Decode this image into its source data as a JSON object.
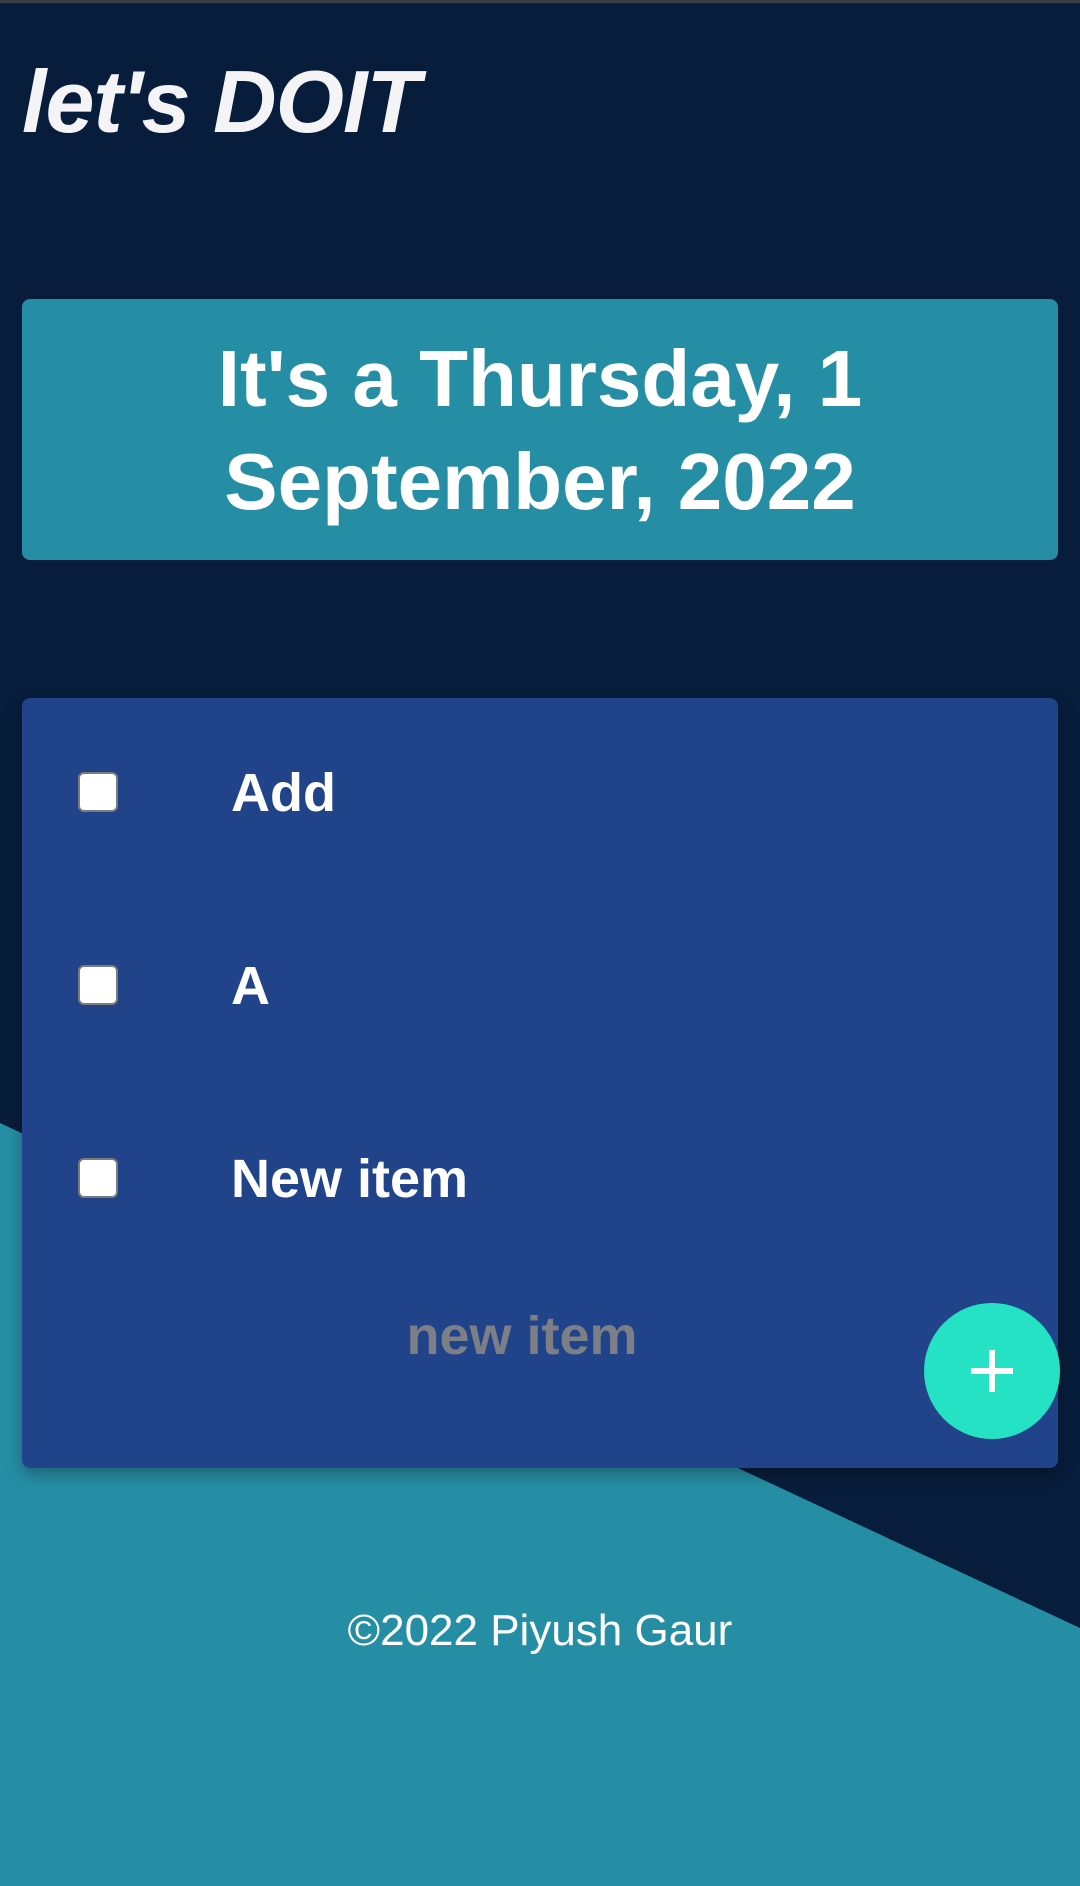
{
  "header": {
    "brand": "let's DOIT"
  },
  "date_banner": {
    "text": "It's a Thursday, 1 September, 2022"
  },
  "todo_list": {
    "items": [
      {
        "label": "Add",
        "checked": false
      },
      {
        "label": "A",
        "checked": false
      },
      {
        "label": "New item",
        "checked": false
      }
    ],
    "new_item_placeholder": "new item",
    "add_button_icon": "plus-icon"
  },
  "footer": {
    "text": "©2022 Piyush Gaur"
  },
  "colors": {
    "background_dark": "#081d3b",
    "accent_teal": "#268ea4",
    "list_card": "#214389",
    "add_button": "#25e2c4",
    "text_light": "#ffffff",
    "placeholder": "#7c7f85"
  }
}
